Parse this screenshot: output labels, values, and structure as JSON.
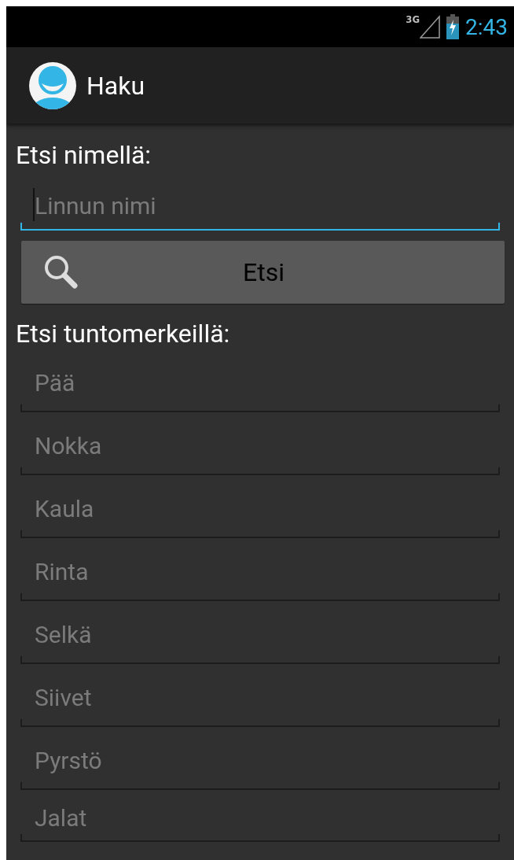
{
  "status_bar": {
    "network": "3G",
    "time": "2:43"
  },
  "action_bar": {
    "title": "Haku"
  },
  "name_search": {
    "label": "Etsi nimellä:",
    "field": {
      "placeholder": "Linnun nimi",
      "focused": true
    }
  },
  "search_button": {
    "label": "Etsi"
  },
  "trait_search": {
    "label": "Etsi tuntomerkeillä:",
    "fields": [
      {
        "placeholder": "Pää",
        "focused": false
      },
      {
        "placeholder": "Nokka",
        "focused": false
      },
      {
        "placeholder": "Kaula",
        "focused": false
      },
      {
        "placeholder": "Rinta",
        "focused": false
      },
      {
        "placeholder": "Selkä",
        "focused": false
      },
      {
        "placeholder": "Siivet",
        "focused": false
      },
      {
        "placeholder": "Pyrstö",
        "focused": false
      },
      {
        "placeholder": "Jalat",
        "focused": false
      }
    ]
  }
}
